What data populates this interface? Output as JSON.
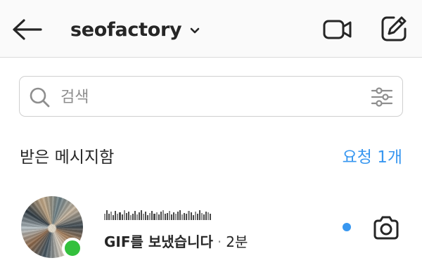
{
  "header": {
    "account_name": "seofactory",
    "back_icon": "arrow-left-icon",
    "dropdown_icon": "chevron-down-icon",
    "video_icon": "video-camera-icon",
    "compose_icon": "compose-icon"
  },
  "search": {
    "placeholder": "검색",
    "icon": "search-icon",
    "filter_icon": "sliders-icon"
  },
  "inbox": {
    "title": "받은 메시지함",
    "requests_label": "요청 1개"
  },
  "threads": [
    {
      "username_obscured": true,
      "message": "GIF를 보냈습니다",
      "separator": "·",
      "time": "2분",
      "online": true,
      "unread": true,
      "camera_icon": "camera-icon"
    }
  ],
  "colors": {
    "accent": "#3897f0",
    "online": "#33c03c",
    "text": "#262626",
    "header_bg": "#fafafa",
    "border": "#dbdbdb"
  }
}
